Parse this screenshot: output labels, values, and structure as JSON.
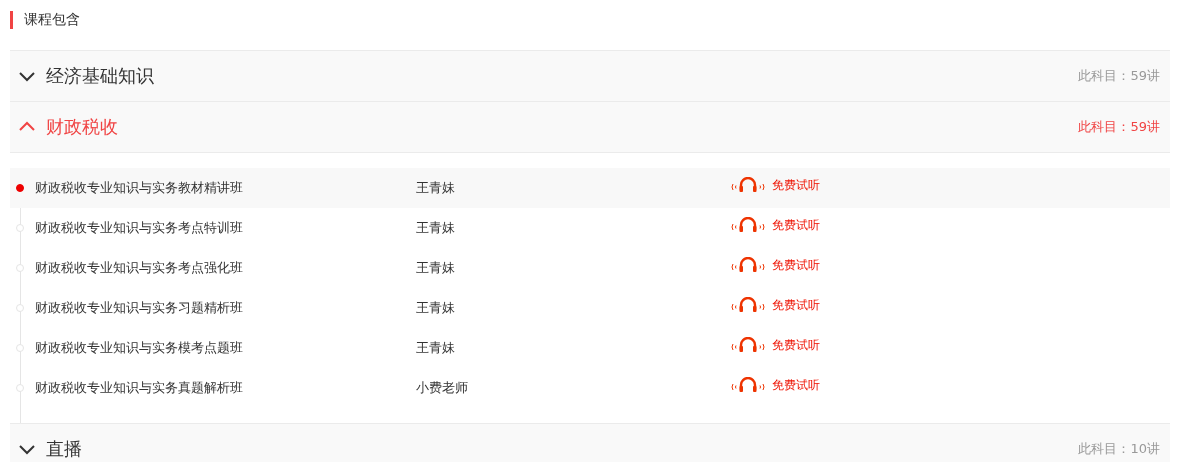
{
  "heading": "课程包含",
  "sections": [
    {
      "title": "经济基础知识",
      "count": "此科目：59讲",
      "expanded": false
    },
    {
      "title": "财政税收",
      "count": "此科目：59讲",
      "expanded": true,
      "lessons": [
        {
          "title": "财政税收专业知识与实务教材精讲班",
          "teacher": "王青妹",
          "trial": "免费试听",
          "selected": true
        },
        {
          "title": "财政税收专业知识与实务考点特训班",
          "teacher": "王青妹",
          "trial": "免费试听",
          "selected": false
        },
        {
          "title": "财政税收专业知识与实务考点强化班",
          "teacher": "王青妹",
          "trial": "免费试听",
          "selected": false
        },
        {
          "title": "财政税收专业知识与实务习题精析班",
          "teacher": "王青妹",
          "trial": "免费试听",
          "selected": false
        },
        {
          "title": "财政税收专业知识与实务模考点题班",
          "teacher": "王青妹",
          "trial": "免费试听",
          "selected": false
        },
        {
          "title": "财政税收专业知识与实务真题解析班",
          "teacher": "小费老师",
          "trial": "免费试听",
          "selected": false
        }
      ]
    },
    {
      "title": "直播",
      "count": "此科目：10讲",
      "expanded": false
    }
  ]
}
